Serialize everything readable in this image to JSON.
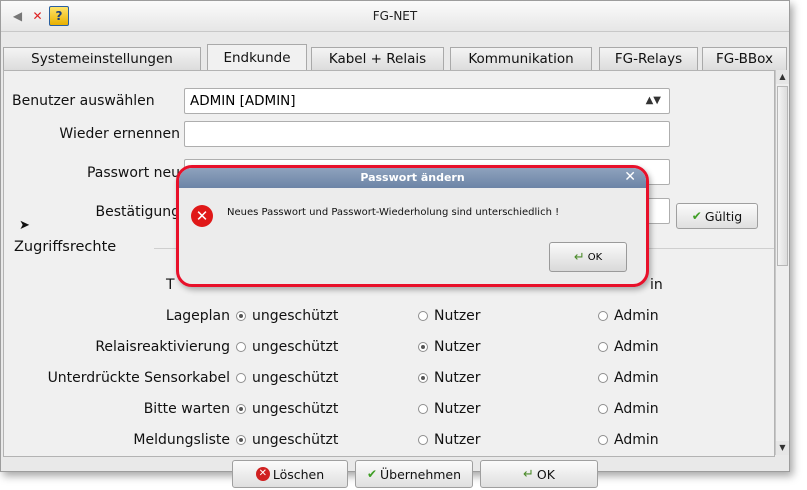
{
  "window": {
    "title": "FG-NET"
  },
  "tabs": [
    {
      "label": "Systemeinstellungen"
    },
    {
      "label": "Endkunde"
    },
    {
      "label": "Kabel + Relais"
    },
    {
      "label": "Kommunikation"
    },
    {
      "label": "FG-Relays"
    },
    {
      "label": "FG-BBox"
    }
  ],
  "active_tab": "Endkunde",
  "form": {
    "user_label": "Benutzer auswählen",
    "user_value": "ADMIN [ADMIN]",
    "rename_label": "Wieder ernennen",
    "rename_value": "",
    "password_label": "Passwort neu",
    "password_value": "",
    "confirm_label": "Bestätigung",
    "confirm_value": "",
    "valid_button": "Gültig"
  },
  "access": {
    "heading": "Zugriffsrechte",
    "partial_row_label_start": "T",
    "partial_row_right": "in",
    "options": [
      "ungeschützt",
      "Nutzer",
      "Admin"
    ],
    "rows": [
      {
        "label": "Lageplan",
        "selected": 0
      },
      {
        "label": "Relaisreaktivierung",
        "selected": 1
      },
      {
        "label": "Unterdrückte Sensorkabel",
        "selected": 1
      },
      {
        "label": "Bitte warten",
        "selected": 0
      },
      {
        "label": "Meldungsliste",
        "selected": 0
      }
    ]
  },
  "buttons": {
    "delete": "Löschen",
    "apply": "Übernehmen",
    "ok": "OK"
  },
  "dialog": {
    "title": "Passwort ändern",
    "message": "Neues Passwort und Passwort-Wiederholung sind unterschiedlich !",
    "ok": "OK"
  },
  "colors": {
    "highlight_border": "#e8102a",
    "dialog_title_bar": "#7a90b0",
    "error_icon": "#e01818"
  }
}
